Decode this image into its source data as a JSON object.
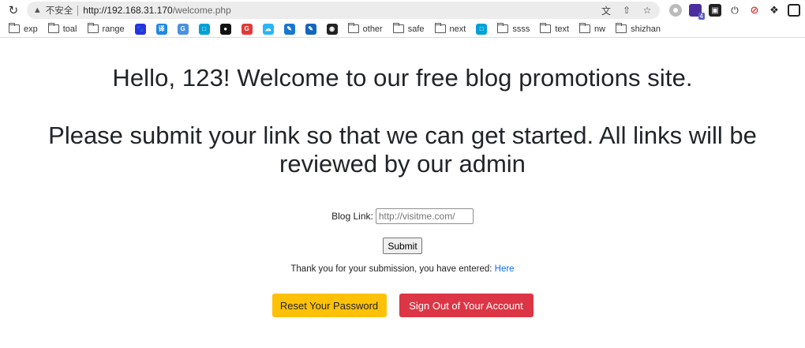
{
  "browser": {
    "security_label": "不安全",
    "url_host": "http://192.168.31.170",
    "url_path": "/welcome.php",
    "extension_badge": "4",
    "colors": {
      "omnibox_bg": "#ececec"
    }
  },
  "bookmarks": [
    {
      "type": "folder",
      "label": "exp"
    },
    {
      "type": "folder",
      "label": "toal"
    },
    {
      "type": "folder",
      "label": "range"
    },
    {
      "type": "icon",
      "icon": "baidu-icon",
      "label": ""
    },
    {
      "type": "icon",
      "icon": "translate-icon",
      "label": ""
    },
    {
      "type": "icon",
      "icon": "google-translate-icon",
      "label": ""
    },
    {
      "type": "icon",
      "icon": "bilibili-icon",
      "label": ""
    },
    {
      "type": "icon",
      "icon": "github-icon",
      "label": ""
    },
    {
      "type": "icon",
      "icon": "red-g-icon",
      "label": ""
    },
    {
      "type": "icon",
      "icon": "cloud-icon",
      "label": ""
    },
    {
      "type": "icon",
      "icon": "blue-pen-icon",
      "label": ""
    },
    {
      "type": "icon",
      "icon": "blue-feather-icon",
      "label": ""
    },
    {
      "type": "icon",
      "icon": "globe-icon",
      "label": ""
    },
    {
      "type": "folder",
      "label": "other"
    },
    {
      "type": "folder",
      "label": "safe"
    },
    {
      "type": "folder",
      "label": "next"
    },
    {
      "type": "icon",
      "icon": "bilibili-icon",
      "label": ""
    },
    {
      "type": "folder",
      "label": "ssss"
    },
    {
      "type": "folder",
      "label": "text"
    },
    {
      "type": "folder",
      "label": "nw"
    },
    {
      "type": "folder",
      "label": "shizhan"
    }
  ],
  "page": {
    "greeting": "Hello, 123! Welcome to our free blog promotions site.",
    "instructions": "Please submit your link so that we can get started. All links will be reviewed by our admin",
    "form": {
      "label": "Blog Link:",
      "placeholder": "http://visitme.com/",
      "submit_label": "Submit"
    },
    "thanks_text": "Thank you for your submission, you have entered:",
    "thanks_link": "Here",
    "reset_label": "Reset Your Password",
    "signout_label": "Sign Out of Your Account",
    "colors": {
      "warning": "#ffc107",
      "danger": "#dc3545",
      "link": "#0d6efd"
    }
  }
}
